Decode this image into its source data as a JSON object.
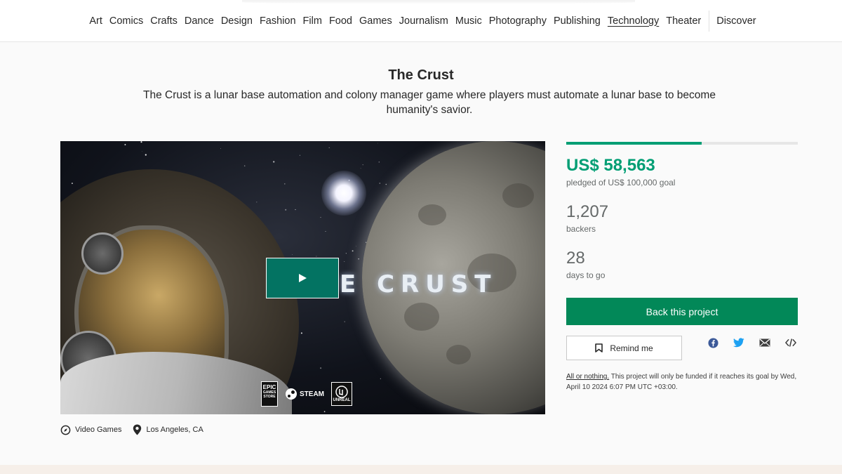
{
  "nav": {
    "categories": [
      "Art",
      "Comics",
      "Crafts",
      "Dance",
      "Design",
      "Fashion",
      "Film",
      "Food",
      "Games",
      "Journalism",
      "Music",
      "Photography",
      "Publishing",
      "Technology",
      "Theater"
    ],
    "active": "Technology",
    "discover_label": "Discover"
  },
  "project": {
    "title": "The Crust",
    "blurb": "The Crust is a lunar base automation and colony manager game where players must automate a lunar base to become humanity's savior.",
    "video": {
      "logo_text": "E CRUST",
      "store_badges": {
        "epic_lines": [
          "EPIC",
          "GAMES",
          "STORE"
        ],
        "steam_label": "STEAM",
        "unreal_label": "UNREAL"
      }
    },
    "category": "Video Games",
    "location": "Los Angeles, CA"
  },
  "stats": {
    "progress_fraction": 0.58563,
    "pledged_amount": "US$ 58,563",
    "pledged_label": "pledged of US$ 100,000 goal",
    "backers_count": "1,207",
    "backers_label": "backers",
    "days_count": "28",
    "days_label": "days to go"
  },
  "actions": {
    "back_label": "Back this project",
    "remind_label": "Remind me",
    "share": [
      "facebook-icon",
      "twitter-icon",
      "email-icon",
      "embed-icon"
    ]
  },
  "funding_note": {
    "link_text": "All or nothing.",
    "text": " This project will only be funded if it reaches its goal by Wed, April 10 2024 6:07 PM UTC +03:00."
  },
  "colors": {
    "accent": "#009e74",
    "button": "#028858",
    "play": "#037362",
    "twitter": "#1da1f2",
    "facebook": "#3b5998"
  }
}
